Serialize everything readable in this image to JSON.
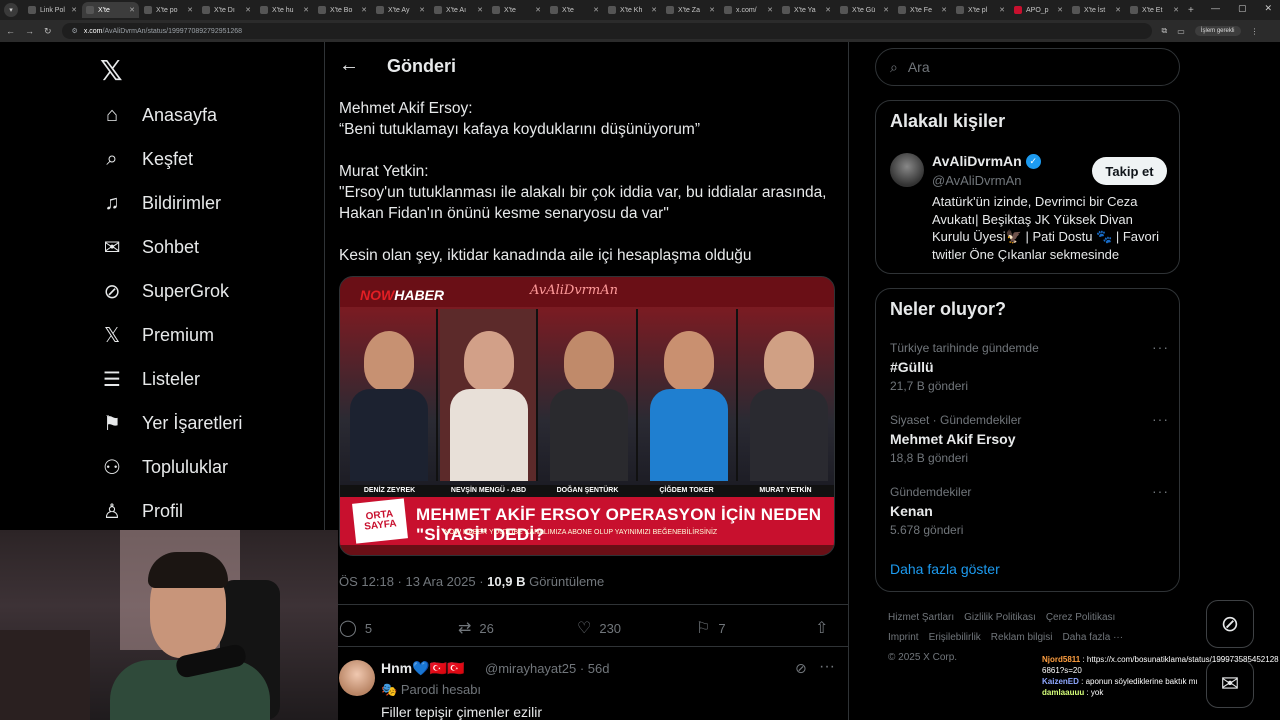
{
  "browser": {
    "tabs": [
      "Link Pol",
      "X'te",
      "X'te po",
      "X'te Dı",
      "X'te hu",
      "X'te Bo",
      "X'te Ay",
      "X'te Aı",
      "X'te",
      "X'te",
      "X'te Kh",
      "X'te Za",
      "x.com/",
      "X'te Ya",
      "X'te Gü",
      "X'te Fe",
      "X'te pl",
      "APO_p",
      "X'te İst",
      "X'te Et"
    ],
    "url_host": "x.com",
    "url_path": "/AvAliDvrmAn/status/1999770892792951268",
    "profile_label": "İşlem gerekli"
  },
  "nav": {
    "items": [
      {
        "label": "Anasayfa",
        "icon": "home-icon"
      },
      {
        "label": "Keşfet",
        "icon": "search-icon"
      },
      {
        "label": "Bildirimler",
        "icon": "bell-icon"
      },
      {
        "label": "Sohbet",
        "icon": "mail-icon"
      },
      {
        "label": "SuperGrok",
        "icon": "grok-icon"
      },
      {
        "label": "Premium",
        "icon": "x-icon"
      },
      {
        "label": "Listeler",
        "icon": "list-icon"
      },
      {
        "label": "Yer İşaretleri",
        "icon": "bookmark-icon"
      },
      {
        "label": "Topluluklar",
        "icon": "people-icon"
      },
      {
        "label": "Profil",
        "icon": "person-icon"
      }
    ]
  },
  "post": {
    "header_title": "Gönderi",
    "text_lines": [
      "Mehmet Akif Ersoy:",
      "“Beni tutuklamayı kafaya koyduklarını düşünüyorum”",
      "Murat Yetkin:",
      "\"Ersoy'un tutuklanması ile alakalı bir çok iddia var, bu iddialar arasında,",
      "Hakan Fidan'ın önünü kesme senaryosu da var\"",
      "Kesin olan şey, iktidar kanadında aile içi hesaplaşma olduğu"
    ],
    "media": {
      "brand_now": "NOW",
      "brand_haber": "HABER",
      "watermark": "AvAliDvrmAn",
      "names": [
        "DENİZ ZEYREK",
        "NEVŞİN MENGÜ - ABD",
        "DOĞAN ŞENTÜRK",
        "ÇİĞDEM TOKER",
        "MURAT YETKİN"
      ],
      "tag": "ORTA SAYFA",
      "headline": "MEHMET AKİF ERSOY OPERASYON İÇİN NEDEN \"SİYASİ\" DEDİ?",
      "subline": "NOW HABER YOUTUBE KANALIMIZA ABONE OLUP YAYINIMIZI BEĞENEBİLİRSİNİZ"
    },
    "meta_time": "ÖS 12:18 · 13 Ara 2025 · ",
    "views": "10,9 B",
    "views_label": "Görüntüleme",
    "stats": {
      "replies": "5",
      "reposts": "26",
      "likes": "230",
      "bookmarks": "7"
    }
  },
  "reply": {
    "name": "Hnm💙🇹🇷🇹🇷",
    "handle": "@mirayhayat25 · 56d",
    "parody": "Parodi hesabı",
    "text": "Filler tepişir çimenler ezilir"
  },
  "sidebar": {
    "search_placeholder": "Ara",
    "related_title": "Alakalı kişiler",
    "person": {
      "name": "AvAliDvrmAn",
      "handle": "@AvAliDvrmAn",
      "follow_label": "Takip et",
      "bio": "Atatürk'ün izinde, Devrimci bir Ceza Avukatı| Beşiktaş JK Yüksek Divan Kurulu Üyesi🦅 | Pati Dostu 🐾 | Favori twitler Öne Çıkanlar sekmesinde"
    },
    "trends_title": "Neler oluyor?",
    "trends": [
      {
        "context": "Türkiye tarihinde gündemde",
        "title": "#Güllü",
        "count": "21,7 B gönderi"
      },
      {
        "context": "Siyaset · Gündemdekiler",
        "title": "Mehmet Akif Ersoy",
        "count": "18,8 B gönderi"
      },
      {
        "context": "Gündemdekiler",
        "title": "Kenan",
        "count": "5.678 gönderi"
      }
    ],
    "show_more": "Daha fazla göster",
    "footer": [
      "Hizmet Şartları",
      "Gizlilik Politikası",
      "Çerez Politikası",
      "Imprint",
      "Erişilebilirlik",
      "Reklam bilgisi",
      "Daha fazla ···",
      "© 2025 X Corp."
    ]
  },
  "chat": [
    {
      "user": "Njord5811",
      "text": "https://x.com/bosunatiklama/status/1999735854521286861?s=20",
      "color": "#ff9f40"
    },
    {
      "user": "KaizenED",
      "text": "aponun söylediklerine baktık mı",
      "color": "#8fa8ff"
    },
    {
      "user": "damlaauuu",
      "text": "yok",
      "color": "#d6ff7a"
    }
  ],
  "colors": {
    "accent": "#1d9bf0",
    "background": "#000000",
    "border": "#2f3336",
    "muted": "#71767b"
  }
}
